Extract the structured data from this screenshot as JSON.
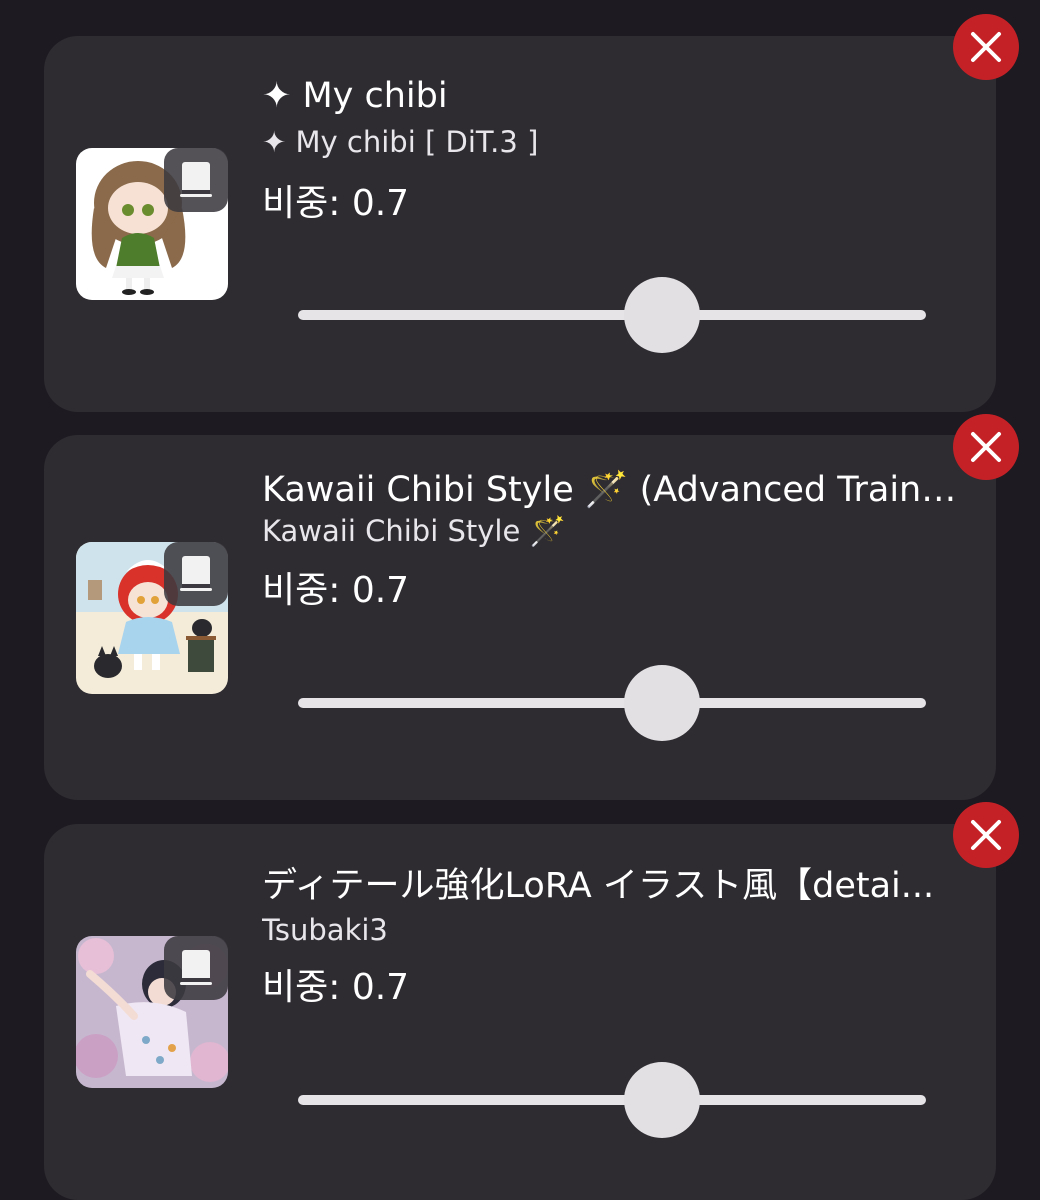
{
  "items": [
    {
      "title": "✦ My chibi",
      "subtitle": "✦ My chibi [ DiT.3 ]",
      "weight_label": "비중:",
      "weight_value": "0.7",
      "slider_fraction": 0.58,
      "thumbnail_icon": "chibi-girl-green-dress-image",
      "badge_icon": "book-icon"
    },
    {
      "title": "Kawaii Chibi Style 🪄 (Advanced Traini...",
      "subtitle": "Kawaii Chibi Style 🪄",
      "weight_label": "비중:",
      "weight_value": "0.7",
      "slider_fraction": 0.58,
      "thumbnail_icon": "chibi-maid-red-hair-cats-image",
      "badge_icon": "book-icon"
    },
    {
      "title": "ディテール強化LoRA イラスト風【detai...",
      "subtitle": "Tsubaki3",
      "weight_label": "비중:",
      "weight_value": "0.7",
      "slider_fraction": 0.58,
      "thumbnail_icon": "anime-girl-flowers-image",
      "badge_icon": "book-icon"
    }
  ],
  "close_icon": "close-icon",
  "colors": {
    "background": "#1d1a21",
    "card": "#2e2c31",
    "close_button": "#c42127",
    "slider": "#e6e4e7"
  }
}
